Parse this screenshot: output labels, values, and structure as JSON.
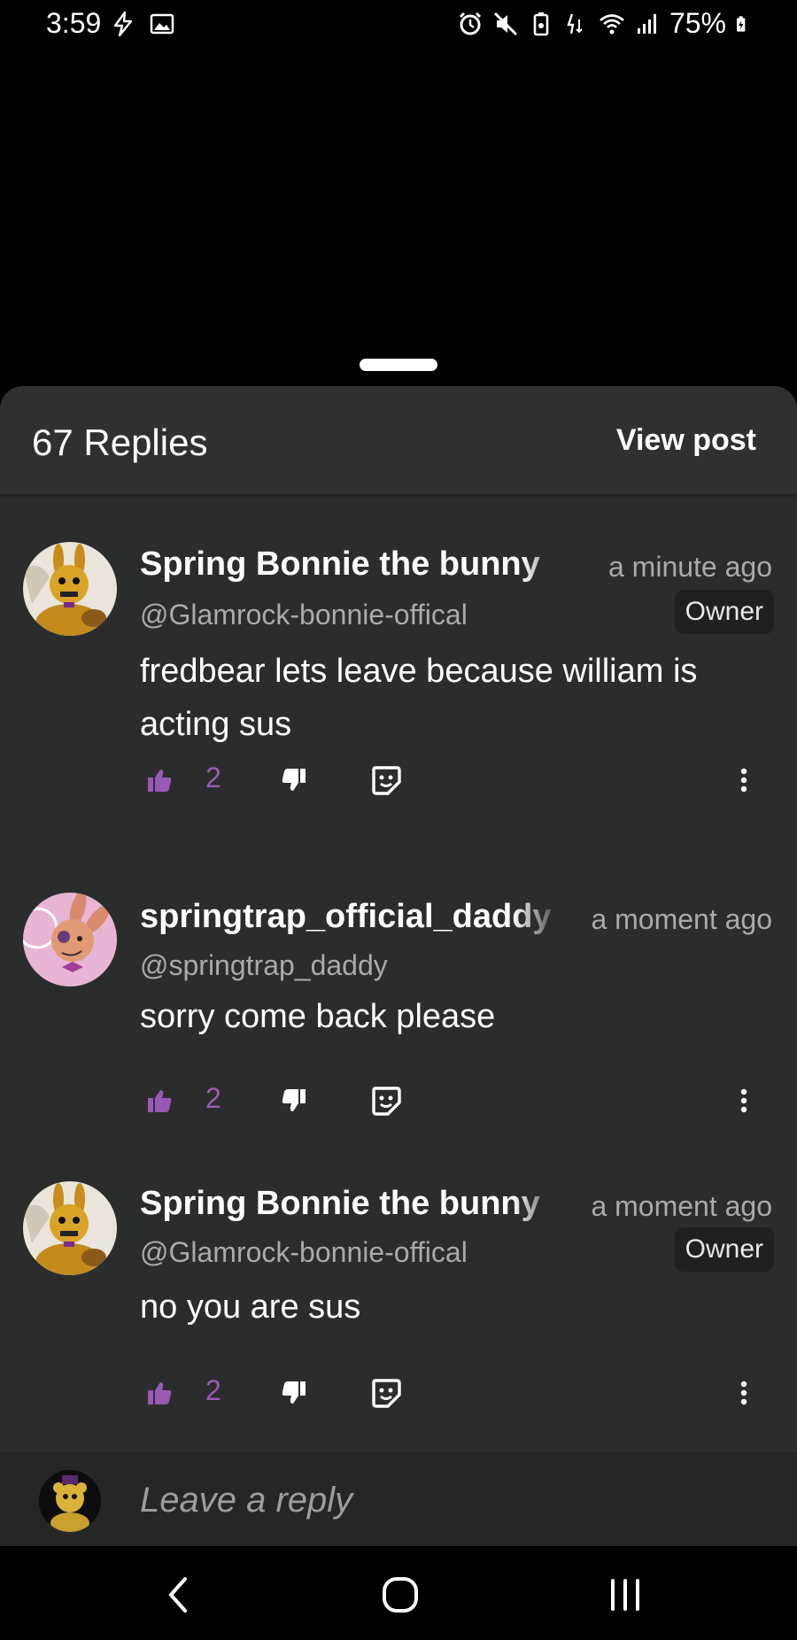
{
  "status_bar": {
    "time": "3:59",
    "battery": "75%"
  },
  "header": {
    "replies_count": "67 Replies",
    "view_post": "View post"
  },
  "comments": [
    {
      "name": "Spring Bonnie the bunny",
      "time": "a minute ago",
      "handle": "@Glamrock-bonnie-offical",
      "badge": "Owner",
      "text": "fredbear lets leave because william is acting sus",
      "likes": "2"
    },
    {
      "name": "springtrap_official_daddy",
      "time": "a moment ago",
      "handle": "@springtrap_daddy",
      "badge": "",
      "text": "sorry come back please",
      "likes": "2"
    },
    {
      "name": "Spring Bonnie the bunny",
      "time": "a moment ago",
      "handle": "@Glamrock-bonnie-offical",
      "badge": "Owner",
      "text": "no you are sus",
      "likes": "2"
    }
  ],
  "reply_bar": {
    "placeholder": "Leave a reply"
  },
  "colors": {
    "accent_purple": "#9b59b6",
    "sheet_bg": "#2b2d2d",
    "muted_text": "#a9abab"
  },
  "icons": {
    "like": "thumbs-up-icon",
    "dislike": "thumbs-down-icon",
    "sticker": "sticker-icon",
    "more": "more-vertical-icon"
  }
}
